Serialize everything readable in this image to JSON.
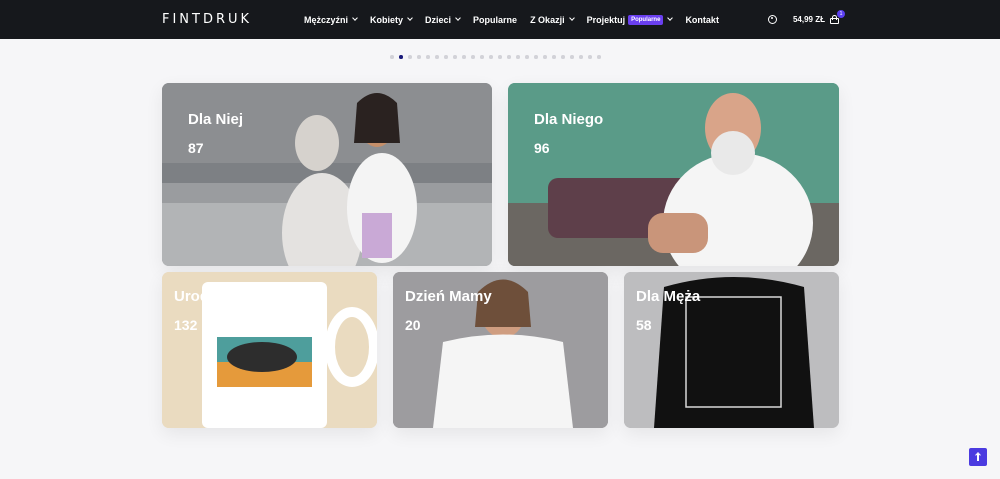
{
  "header": {
    "logo": "FINTDRUK",
    "nav": [
      {
        "label": "Mężczyźni",
        "dropdown": true
      },
      {
        "label": "Kobiety",
        "dropdown": true
      },
      {
        "label": "Dzieci",
        "dropdown": true
      },
      {
        "label": "Popularne",
        "dropdown": false
      },
      {
        "label": "Z Okazji",
        "dropdown": true
      },
      {
        "label": "Projektuj",
        "badge": "Popularne",
        "dropdown": true
      },
      {
        "label": "Kontakt",
        "dropdown": false
      }
    ],
    "cart_total": "54,99 ZŁ",
    "cart_count": "1",
    "icons": {
      "account": "user-icon",
      "cart": "shopping-bag-icon"
    }
  },
  "slider": {
    "dots": 24,
    "active_dot_index": 1
  },
  "categories": [
    {
      "title": "Dla Niej",
      "count": "87"
    },
    {
      "title": "Dla Niego",
      "count": "96"
    },
    {
      "title": "Urodzinowe",
      "count": "132"
    },
    {
      "title": "Dzień Mamy",
      "count": "20"
    },
    {
      "title": "Dla Męża",
      "count": "58"
    }
  ],
  "colors": {
    "header_bg": "#16181c",
    "accent": "#5b3ff0"
  }
}
